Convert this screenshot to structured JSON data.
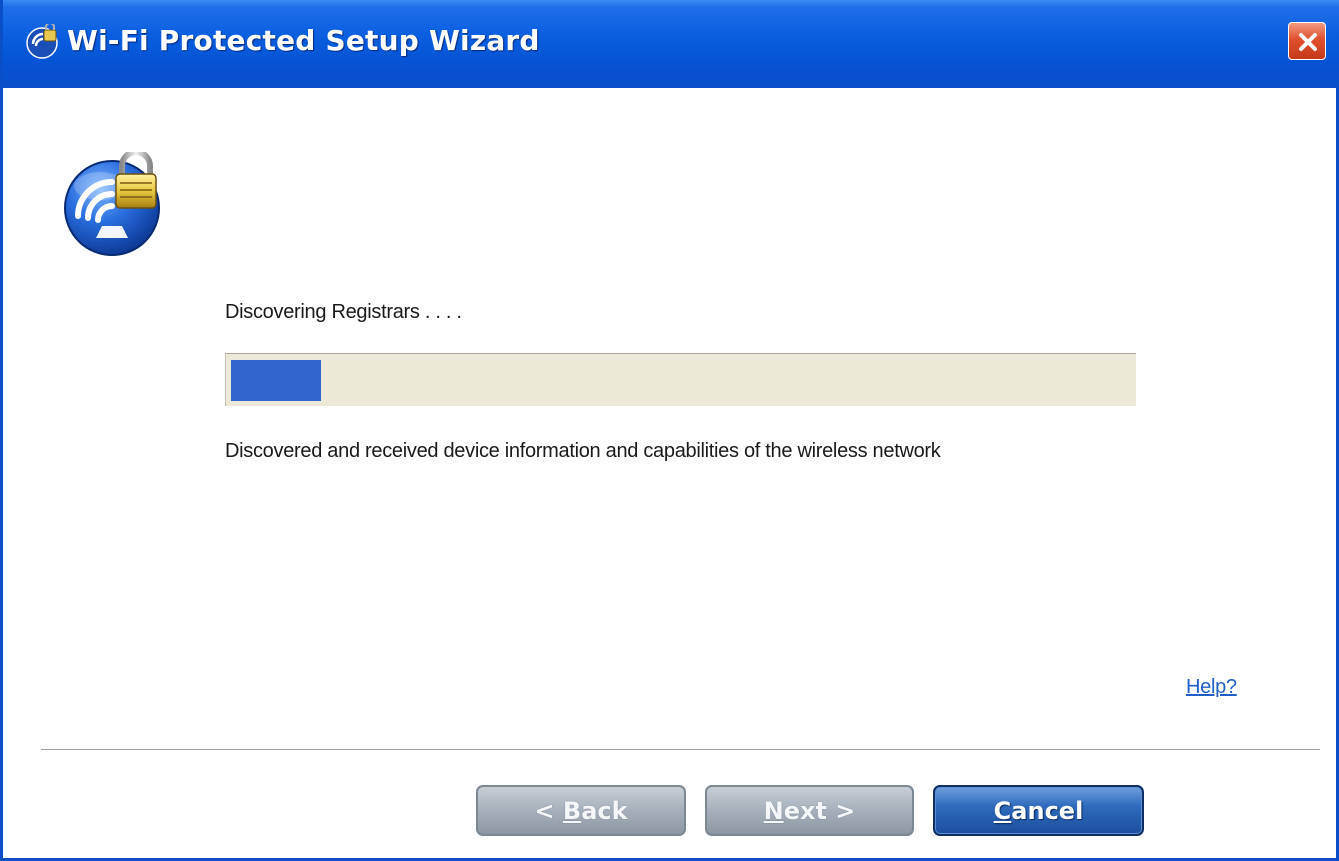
{
  "window": {
    "title": "Wi-Fi Protected Setup Wizard"
  },
  "icons": {
    "app": "wifi-lock-small-icon",
    "close": "close-icon",
    "main": "wifi-lock-icon"
  },
  "wizard": {
    "status": "Discovering Registrars . . . .",
    "progress_fraction": 0.1,
    "info": "Discovered and received device information and capabilities of the wireless network",
    "help_link": "Help?"
  },
  "buttons": {
    "back": {
      "prefix": "< ",
      "accel": "B",
      "rest": "ack",
      "enabled": false
    },
    "next": {
      "prefix": "",
      "accel": "N",
      "rest": "ext >",
      "enabled": false
    },
    "cancel": {
      "prefix": "",
      "accel": "C",
      "rest": "ancel",
      "enabled": true
    }
  },
  "colors": {
    "titlebar": "#0a5ee0",
    "progress_fill": "#3366cc",
    "progress_track": "#ece9d8",
    "link": "#1f5fc8"
  }
}
